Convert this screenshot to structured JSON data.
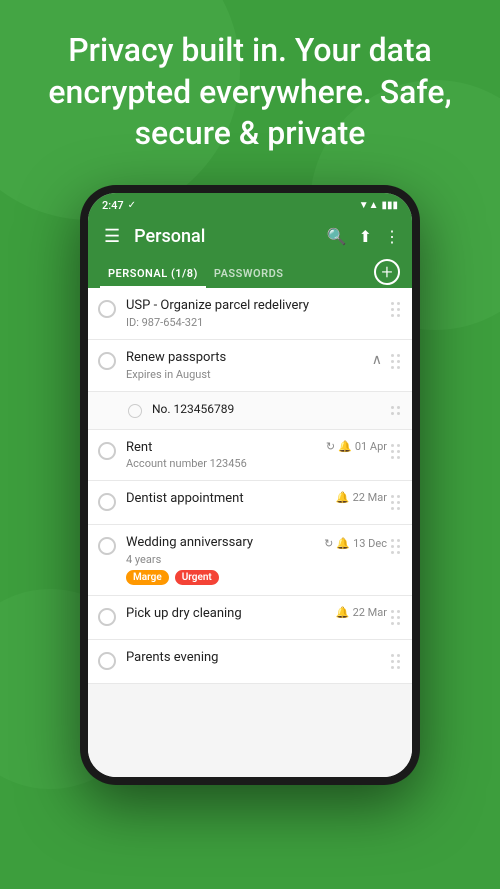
{
  "hero": {
    "text": "Privacy built in. Your data encrypted everywhere. Safe, secure & private"
  },
  "status_bar": {
    "time": "2:47",
    "check": "✓"
  },
  "toolbar": {
    "title": "Personal",
    "menu_icon": "☰",
    "search_icon": "🔍",
    "share_icon": "⬆",
    "more_icon": "⋮"
  },
  "tabs": [
    {
      "label": "PERSONAL (1/8)",
      "active": true
    },
    {
      "label": "PASSWORDS",
      "active": false
    }
  ],
  "add_button": "+",
  "list_items": [
    {
      "id": 1,
      "title": "USP - Organize parcel redelivery",
      "subtitle": "ID: 987-654-321",
      "has_radio": true,
      "date": null,
      "repeat": null,
      "badges": [],
      "expanded": false
    },
    {
      "id": 2,
      "title": "Renew passports",
      "subtitle": "Expires in August",
      "has_radio": true,
      "date": null,
      "repeat": null,
      "badges": [],
      "expanded": true
    },
    {
      "id": 3,
      "title": "No. 123456789",
      "subtitle": null,
      "has_radio": true,
      "is_sub": true,
      "date": null,
      "repeat": null,
      "badges": []
    },
    {
      "id": 4,
      "title": "Rent",
      "subtitle": "Account number 123456",
      "has_radio": true,
      "date": "01 Apr",
      "repeat": true,
      "bell": true,
      "badges": []
    },
    {
      "id": 5,
      "title": "Dentist appointment",
      "subtitle": null,
      "has_radio": true,
      "date": "22 Mar",
      "repeat": false,
      "bell": true,
      "badges": []
    },
    {
      "id": 6,
      "title": "Wedding anniverssary",
      "subtitle": "4 years",
      "has_radio": true,
      "date": "13 Dec",
      "repeat": true,
      "bell": true,
      "badges": [
        {
          "label": "Marge",
          "type": "orange"
        },
        {
          "label": "Urgent",
          "type": "red"
        }
      ]
    },
    {
      "id": 7,
      "title": "Pick up dry cleaning",
      "subtitle": null,
      "has_radio": true,
      "date": "22 Mar",
      "repeat": false,
      "bell": true,
      "badges": []
    },
    {
      "id": 8,
      "title": "Parents evening",
      "subtitle": null,
      "has_radio": true,
      "date": null,
      "repeat": false,
      "bell": false,
      "badges": []
    }
  ],
  "colors": {
    "green": "#388e3c",
    "orange": "#ff9800",
    "red": "#f44336"
  }
}
